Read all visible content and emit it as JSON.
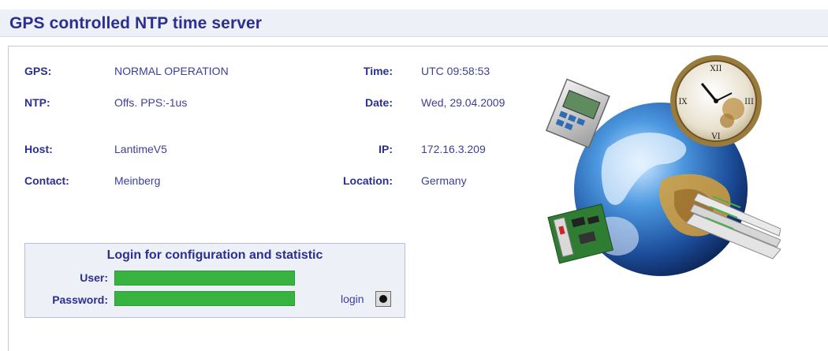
{
  "header": {
    "title": "GPS controlled NTP time server"
  },
  "status": {
    "gps_label": "GPS:",
    "gps_value": "NORMAL OPERATION",
    "ntp_label": "NTP:",
    "ntp_value": "Offs. PPS:-1us",
    "host_label": "Host:",
    "host_value": "LantimeV5",
    "contact_label": "Contact:",
    "contact_value": "Meinberg",
    "time_label": "Time:",
    "time_value": "UTC 09:58:53",
    "date_label": "Date:",
    "date_value": "Wed, 29.04.2009",
    "ip_label": "IP:",
    "ip_value": "172.16.3.209",
    "location_label": "Location:",
    "location_value": "Germany"
  },
  "login": {
    "title": "Login for configuration and statistic",
    "user_label": "User:",
    "password_label": "Password:",
    "button_label": "login",
    "user_value": "",
    "password_value": ""
  },
  "colors": {
    "heading": "#2b2f8f",
    "text": "#3c3f9a",
    "field": "#37b43f",
    "header_bg": "#eef0f7"
  },
  "icons": {
    "illustration": "globe-clock-devices-illustration",
    "login_button": "radio-dot-icon"
  }
}
